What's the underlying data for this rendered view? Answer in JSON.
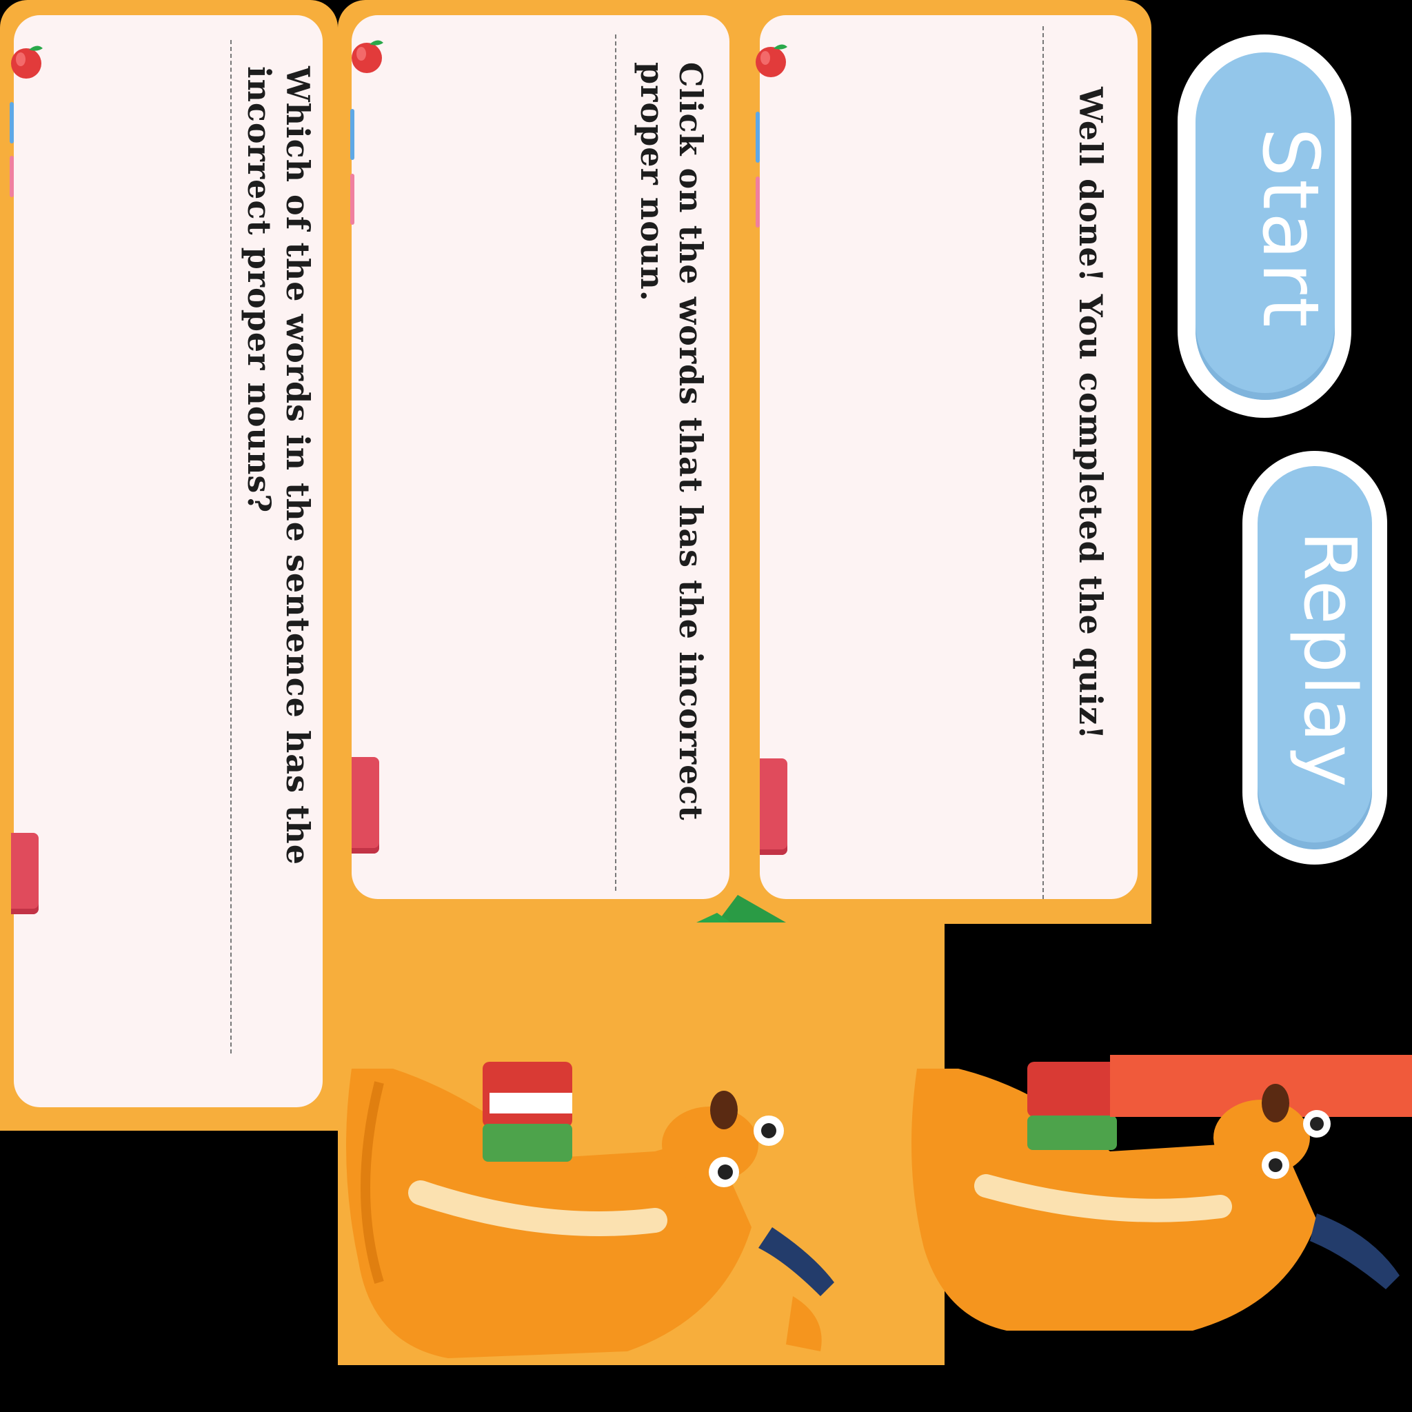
{
  "cards": {
    "question_one": "Which of the words in the sentence has the incorrect proper nouns?",
    "question_two": "Click on the words that has the incorrect proper noun.",
    "completion": "Well done! You completed the quiz!"
  },
  "buttons": {
    "start_label": "Start",
    "replay_label": "Replay"
  },
  "characters": [
    "kangaroo-with-books",
    "kangaroo-with-books"
  ],
  "colors": {
    "board_orange": "#f7ae3c",
    "card_bg": "#fdf3f3",
    "button_blue": "#93c6ea",
    "bookmark_red": "#e04b5c"
  }
}
